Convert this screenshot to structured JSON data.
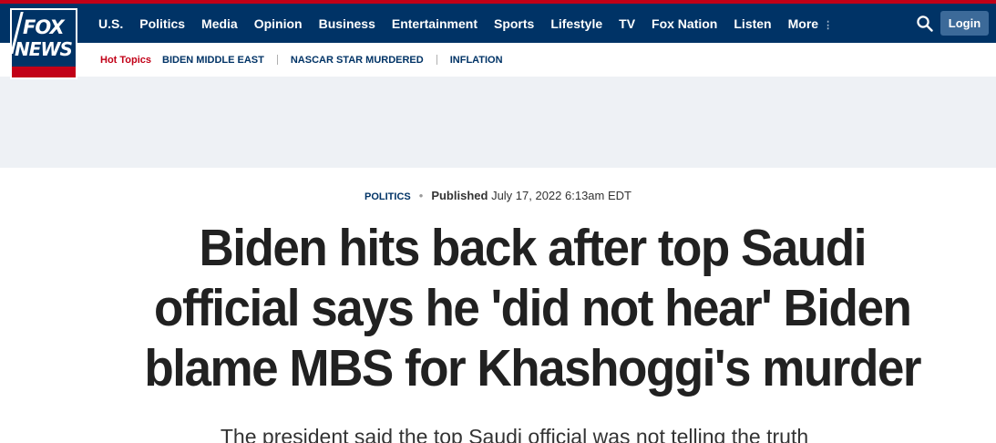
{
  "brand": {
    "logo_line1": "FOX",
    "logo_line2": "NEWS",
    "primary_color": "#003366",
    "accent_color": "#c20017"
  },
  "nav": {
    "items": [
      "U.S.",
      "Politics",
      "Media",
      "Opinion",
      "Business",
      "Entertainment",
      "Sports",
      "Lifestyle",
      "TV",
      "Fox Nation",
      "Listen"
    ],
    "more_label": "More",
    "more_icon": "kebab-icon",
    "search_icon": "search-icon",
    "login_label": "Login"
  },
  "hot_topics": {
    "label": "Hot Topics",
    "items": [
      "BIDEN MIDDLE EAST",
      "NASCAR STAR MURDERED",
      "INFLATION"
    ]
  },
  "article": {
    "category": "POLITICS",
    "published_label": "Published",
    "published_date": "July 17, 2022 6:13am EDT",
    "headline": "Biden hits back after top Saudi official says he 'did not hear' Biden blame MBS for Khashoggi's murder",
    "subhead": "The president said the top Saudi official was not telling the truth"
  }
}
